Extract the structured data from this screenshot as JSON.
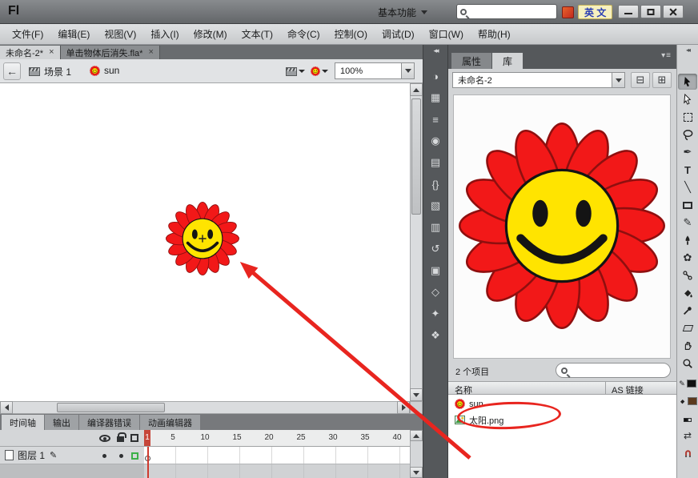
{
  "titlebar": {
    "logo": "Fl",
    "workspace": "基本功能",
    "lang_badge": "英 文"
  },
  "menubar": {
    "items": [
      "文件(F)",
      "编辑(E)",
      "视图(V)",
      "插入(I)",
      "修改(M)",
      "文本(T)",
      "命令(C)",
      "控制(O)",
      "调试(D)",
      "窗口(W)",
      "帮助(H)"
    ]
  },
  "doc_tabs": [
    {
      "label": "未命名-2*",
      "close": "×"
    },
    {
      "label": "单击物体后消失.fla*",
      "close": "×"
    }
  ],
  "edit_bar": {
    "back_glyph": "←",
    "scene": "场景 1",
    "symbol": "sun",
    "zoom": "100%"
  },
  "dock": {
    "collapse_glyph": "◂◂",
    "items": [
      {
        "name": "color-panel",
        "glyph": "◑"
      },
      {
        "name": "swatches-panel",
        "glyph": "▦"
      },
      {
        "name": "align-panel",
        "glyph": "≡"
      },
      {
        "name": "info-panel",
        "glyph": "◉"
      },
      {
        "name": "filters-panel",
        "glyph": "▤"
      },
      {
        "name": "code-snippets-panel",
        "glyph": "{}"
      },
      {
        "name": "components-panel",
        "glyph": "▧"
      },
      {
        "name": "motion-presets-panel",
        "glyph": "▥"
      },
      {
        "name": "history-panel",
        "glyph": "↺"
      },
      {
        "name": "scene-panel",
        "glyph": "▣"
      },
      {
        "name": "transform-panel",
        "glyph": "◇"
      },
      {
        "name": "strings-panel",
        "glyph": "✦"
      },
      {
        "name": "behaviors-panel",
        "glyph": "❖"
      }
    ]
  },
  "panel": {
    "tabs": [
      {
        "label": "属性"
      },
      {
        "label": "库"
      }
    ],
    "menu_glyph": "▾≡",
    "pin_glyph": "⊟",
    "new_panel_glyph": "⊞"
  },
  "library": {
    "document": "未命名-2",
    "count": "2 个项目",
    "columns": {
      "name": "名称",
      "linkage": "AS 链接"
    },
    "items": [
      {
        "name": "sun",
        "type": "graphic-symbol"
      },
      {
        "name": "太阳.png",
        "type": "bitmap"
      }
    ]
  },
  "timeline": {
    "tabs": [
      {
        "label": "时间轴"
      },
      {
        "label": "输出"
      },
      {
        "label": "编译器错误"
      },
      {
        "label": "动画编辑器"
      }
    ],
    "layer": "图层 1",
    "pencil_glyph": "✎",
    "frame_labels": [
      "1",
      "5",
      "10",
      "15",
      "20",
      "25",
      "30",
      "35",
      "40"
    ],
    "current_frame": 1
  },
  "tools": {
    "collapse_glyph": "◂◂",
    "glyphs": {
      "pen": "✒",
      "text": "T",
      "line": "╲",
      "pencil": "✎",
      "deco": "✿",
      "swap": "⇄"
    }
  },
  "colors": {
    "petal": "#f21818",
    "petal-stroke": "#8f0f0f",
    "center": "#ffe400",
    "accent-red": "#e8251f",
    "fill-swatch": "#5c3a1e"
  }
}
